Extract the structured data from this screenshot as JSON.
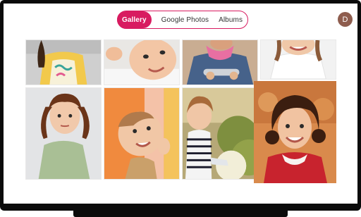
{
  "nav": {
    "tabs": [
      {
        "label": "Gallery",
        "active": true
      },
      {
        "label": "Google Photos",
        "active": false
      },
      {
        "label": "Albums",
        "active": false
      }
    ]
  },
  "user": {
    "avatar_initial": "D"
  },
  "colors": {
    "accent": "#d81b60",
    "frame": "#0b0b0b",
    "avatar": "#8e5d4e"
  },
  "photos": [
    {
      "subject": "girl in yellow jacket"
    },
    {
      "subject": "smiling baby lying down"
    },
    {
      "subject": "child in denim jacket with pink scarf"
    },
    {
      "subject": "smiling girl in white"
    },
    {
      "subject": "girl with pigtails in green sweater"
    },
    {
      "subject": "baby peeking around orange door"
    },
    {
      "subject": "girl in striped shirt among flowers"
    },
    {
      "subject": "curly-haired girl in red dress"
    }
  ]
}
